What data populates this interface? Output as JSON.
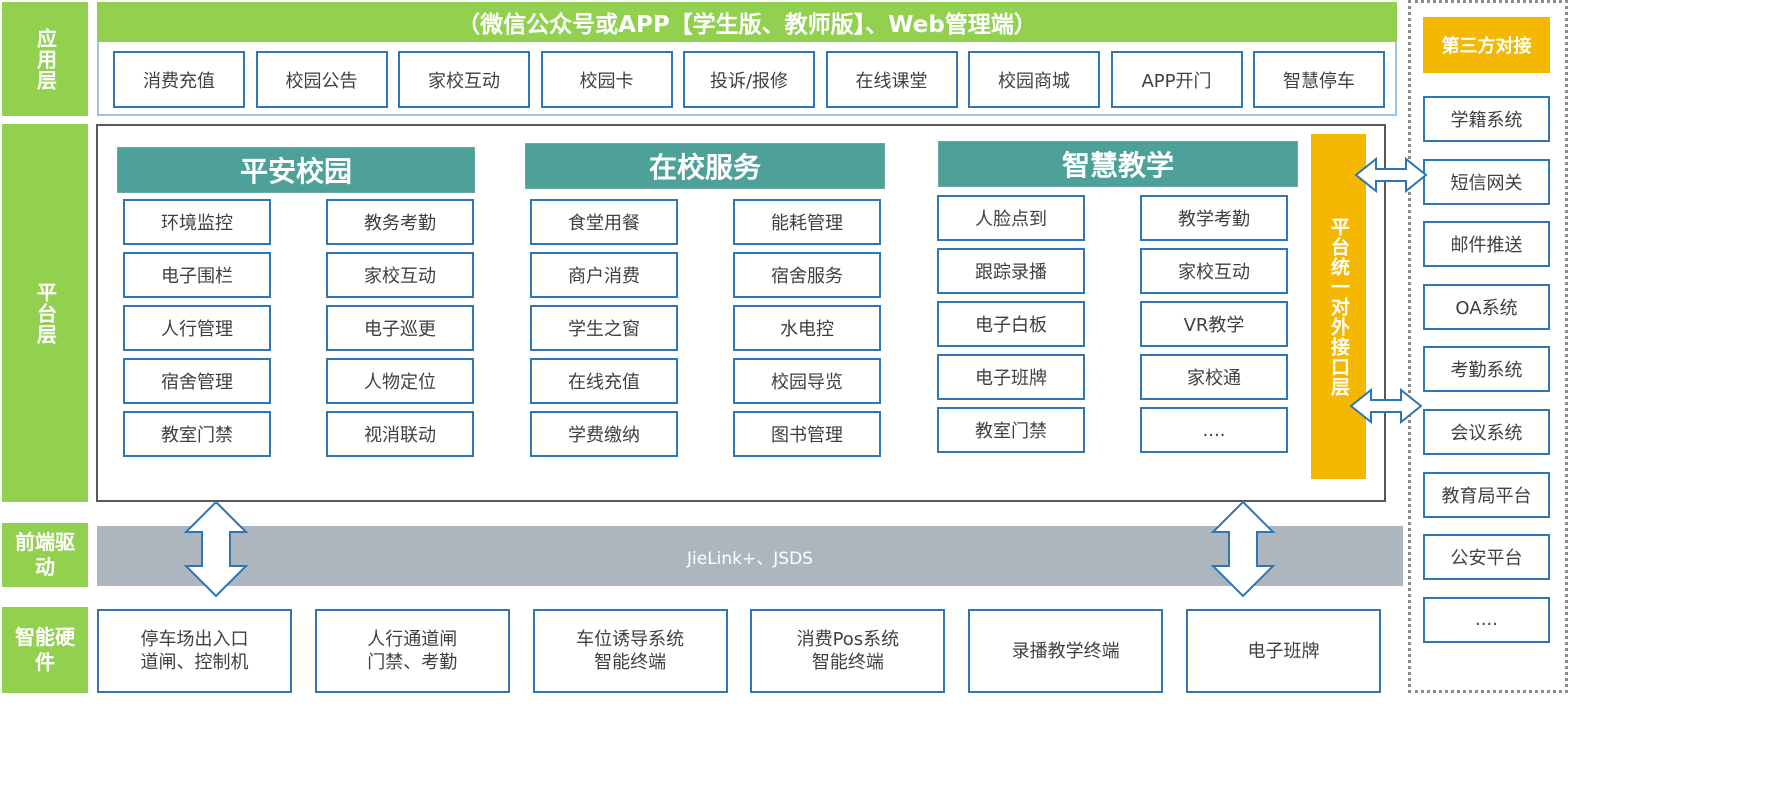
{
  "layers": {
    "app": "应用层",
    "platform": "平台层",
    "driver": "前端驱动",
    "hardware": "智能硬件"
  },
  "app": {
    "banner": "（微信公众号或APP【学生版、教师版】、Web管理端）",
    "items": [
      "消费充值",
      "校园公告",
      "家校互动",
      "校园卡",
      "投诉/报修",
      "在线课堂",
      "校园商城",
      "APP开门",
      "智慧停车"
    ]
  },
  "platform": {
    "safe_campus": {
      "title": "平安校园",
      "left": [
        "环境监控",
        "电子围栏",
        "人行管理",
        "宿舍管理",
        "教室门禁"
      ],
      "right": [
        "教务考勤",
        "家校互动",
        "电子巡更",
        "人物定位",
        "视消联动"
      ]
    },
    "campus_service": {
      "title": "在校服务",
      "left": [
        "食堂用餐",
        "商户消费",
        "学生之窗",
        "在线充值",
        "学费缴纳"
      ],
      "right": [
        "能耗管理",
        "宿舍服务",
        "水电控",
        "校园导览",
        "图书管理"
      ]
    },
    "smart_teaching": {
      "title": "智慧教学",
      "left": [
        "人脸点到",
        "跟踪录播",
        "电子白板",
        "电子班牌",
        "教室门禁"
      ],
      "right": [
        "教学考勤",
        "家校互动",
        "VR教学",
        "家校通",
        "...."
      ]
    },
    "interface_layer": "平台统一对外接口层"
  },
  "driver": {
    "text": "JieLink+、JSDS"
  },
  "hardware": {
    "items": [
      {
        "line1": "停车场出入口",
        "line2": "道闸、控制机"
      },
      {
        "line1": "人行通道闸",
        "line2": "门禁、考勤"
      },
      {
        "line1": "车位诱导系统",
        "line2": "智能终端"
      },
      {
        "line1": "消费Pos系统",
        "line2": "智能终端"
      },
      {
        "line1": "录播教学终端",
        "line2": ""
      },
      {
        "line1": "电子班牌",
        "line2": ""
      }
    ]
  },
  "third_party": {
    "title": "第三方对接",
    "items": [
      "学籍系统",
      "短信网关",
      "邮件推送",
      "OA系统",
      "考勤系统",
      "会议系统",
      "教育局平台",
      "公安平台",
      "...."
    ]
  },
  "colors": {
    "green": "#92d050",
    "teal": "#4ea199",
    "blue_border": "#2e75b6",
    "orange": "#f5b800",
    "gray_bar": "#adb5be"
  }
}
